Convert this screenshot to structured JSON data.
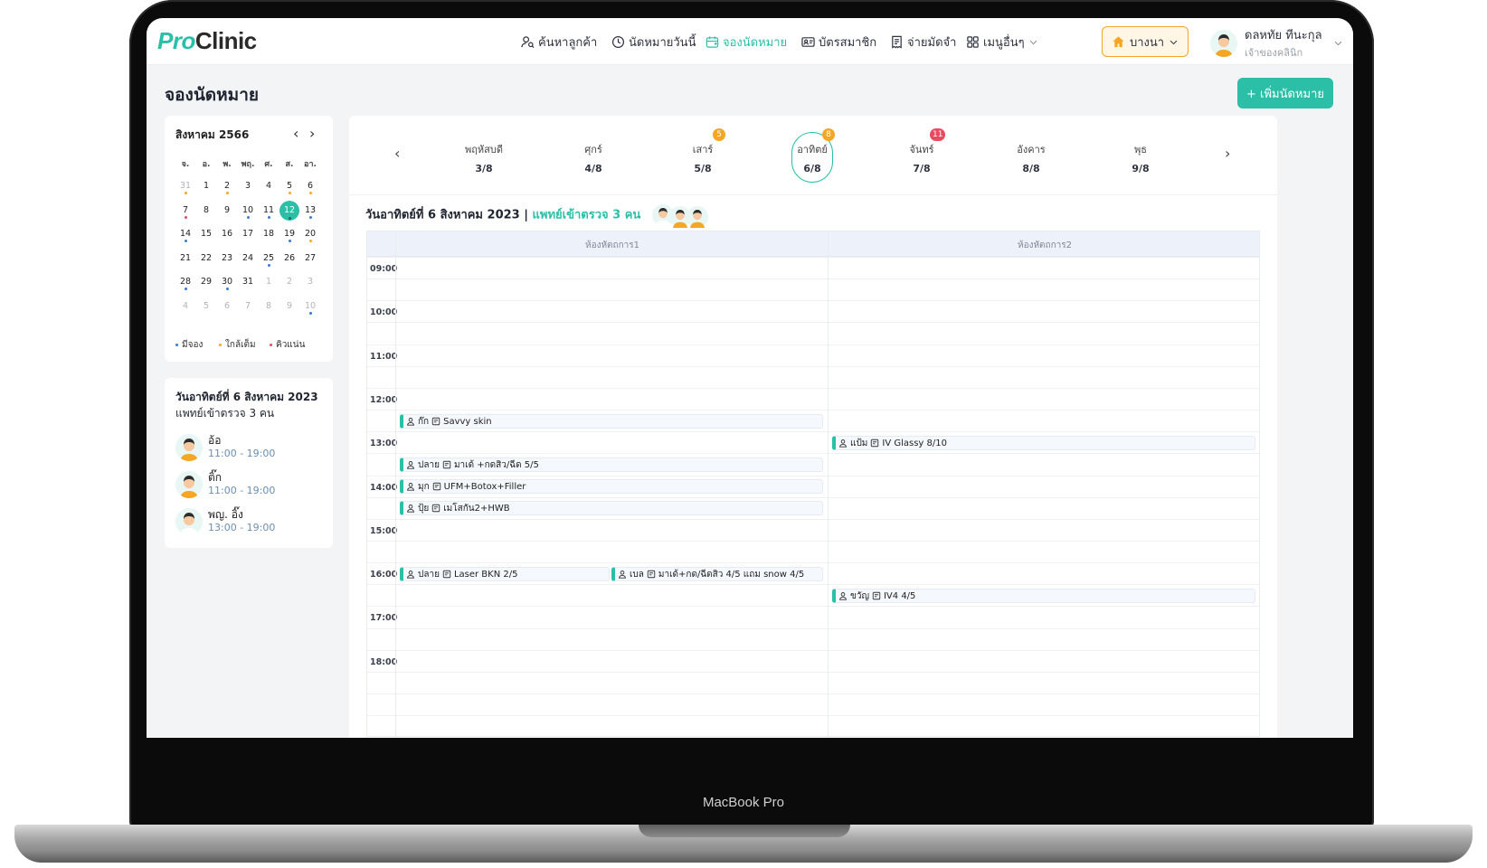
{
  "device": {
    "label": "MacBook Pro"
  },
  "app": {
    "logo": {
      "pro": "Pro",
      "clinic": "Clinic"
    },
    "nav": [
      {
        "label": "ค้นหาลูกค้า",
        "icon": "user-search-icon"
      },
      {
        "label": "นัดหมายวันนี้",
        "icon": "clock-icon"
      },
      {
        "label": "จองนัดหมาย",
        "icon": "calendar-add-icon",
        "active": true
      },
      {
        "label": "บัตรสมาชิก",
        "icon": "id-card-icon"
      },
      {
        "label": "จ่ายมัดจำ",
        "icon": "receipt-icon"
      },
      {
        "label": "เมนูอื่นๆ",
        "icon": "grid-icon"
      }
    ],
    "branch": "บางนา",
    "user": {
      "name": "ดลหทัย ทีนะกุล",
      "role": "เจ้าของคลินิก"
    }
  },
  "page": {
    "title": "จองนัดหมาย",
    "add_button": "+ เพิ่มนัดหมาย"
  },
  "mini_calendar": {
    "title": "สิงหาคม 2566",
    "dow": [
      "อ.",
      "จ.",
      "อ.",
      "พ.",
      "พฤ.",
      "ศ.",
      "ส.",
      "อา."
    ],
    "weeks": [
      [
        "31",
        "1",
        "2",
        "3",
        "4",
        "5",
        "6"
      ],
      [
        "7",
        "8",
        "9",
        "10",
        "11",
        "12",
        "13"
      ],
      [
        "14",
        "15",
        "16",
        "17",
        "18",
        "19",
        "20"
      ],
      [
        "21",
        "22",
        "23",
        "24",
        "25",
        "26",
        "27"
      ],
      [
        "28",
        "29",
        "30",
        "31",
        "1",
        "2",
        "3"
      ],
      [
        "4",
        "5",
        "6",
        "7",
        "8",
        "9",
        "10"
      ]
    ],
    "today": "12",
    "legend": [
      {
        "label": "มีจอง",
        "color": "#3a7bd5"
      },
      {
        "label": "ใกล้เต็ม",
        "color": "#f5a623"
      },
      {
        "label": "คิวแน่น",
        "color": "#e84a5f"
      }
    ]
  },
  "doctor_card": {
    "title": "วันอาทิตย์ที่ 6 สิงหาคม 2023",
    "subtitle": "แพทย์เข้าตรวจ 3 คน",
    "doctors": [
      {
        "name": "อ้อ",
        "time": "11:00 - 19:00"
      },
      {
        "name": "ติ๊ก",
        "time": "11:00 - 19:00"
      },
      {
        "name": "พญ. อิ๊ง",
        "time": "13:00 - 19:00"
      }
    ]
  },
  "days": [
    {
      "name": "พฤหัสบดี",
      "date": "3/8"
    },
    {
      "name": "ศุกร์",
      "date": "4/8"
    },
    {
      "name": "เสาร์",
      "date": "5/8",
      "badge": "5",
      "badge_color": "#f5a623"
    },
    {
      "name": "อาทิตย์",
      "date": "6/8",
      "badge": "8",
      "badge_color": "#f5a623",
      "selected": true
    },
    {
      "name": "จันทร์",
      "date": "7/8",
      "badge": "11",
      "badge_color": "#e84a5f"
    },
    {
      "name": "อังคาร",
      "date": "8/8"
    },
    {
      "name": "พุธ",
      "date": "9/8"
    }
  ],
  "day_header": {
    "date": "วันอาทิตย์ที่ 6 สิงหาคม 2023 |",
    "doctors": "แพทย์เข้าตรวจ 3 คน"
  },
  "rooms": [
    "ห้องหัตถการ1",
    "ห้องหัตถการ2"
  ],
  "times": [
    "09:00",
    "10:00",
    "11:00",
    "12:00",
    "13:00",
    "14:00",
    "15:00",
    "16:00",
    "17:00",
    "18:00"
  ],
  "appointments": [
    {
      "patient": "ก๊ก",
      "service": "Savvy skin"
    },
    {
      "patient": "แป้ม",
      "service": "IV Glassy 8/10"
    },
    {
      "patient": "ปลาย",
      "service": "มาเด้ +กดสิว/ฉีด 5/5"
    },
    {
      "patient": "มุก",
      "service": "UFM+Botox+Filler"
    },
    {
      "patient": "ปุ้ย",
      "service": "เมโสกัน2+HWB"
    },
    {
      "patient": "ปลาย",
      "service": "Laser BKN 2/5"
    },
    {
      "patient": "เบล",
      "service": "มาเด้+กด/ฉีดสิว 4/5 แถม snow 4/5"
    },
    {
      "patient": "ขวัญ",
      "service": "IV4 4/5"
    }
  ],
  "colors": {
    "accent": "#2bbfa8",
    "booked": "#3a7bd5",
    "near_full": "#f5a623",
    "busy": "#e84a5f"
  }
}
